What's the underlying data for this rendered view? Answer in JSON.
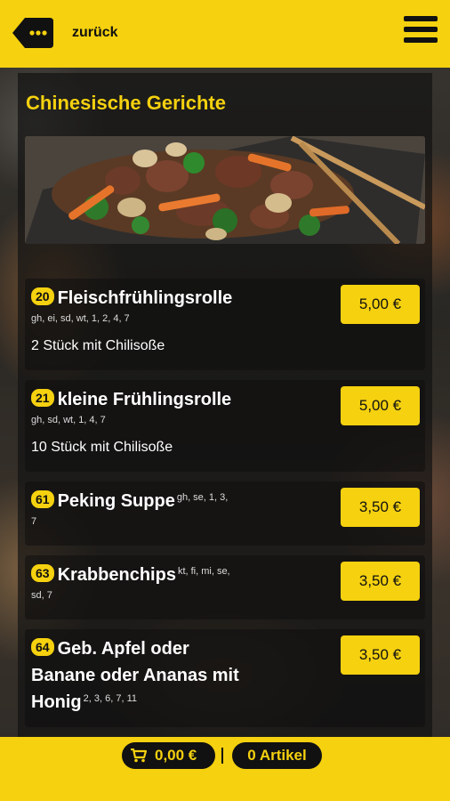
{
  "header": {
    "back_label": "zurück",
    "back_icon": "back-tag-icon",
    "menu_icon": "hamburger-menu-icon"
  },
  "section": {
    "title": "Chinesische Gerichte",
    "image_alt": "beef-broccoli-dish-photo"
  },
  "items": [
    {
      "number": "20",
      "name": "Fleischfrühlingsrolle",
      "allergens": "gh, ei, sd, wt, 1, 2, 4, 7",
      "description": "2 Stück mit Chilisoße",
      "price": "5,00 €"
    },
    {
      "number": "21",
      "name": "kleine Frühlingsrolle",
      "allergens": "gh, sd, wt, 1, 4, 7",
      "description": "10 Stück mit Chilisoße",
      "price": "5,00 €"
    },
    {
      "number": "61",
      "name": "Peking Suppe",
      "allergens_a": "gh, se, 1, 3,",
      "allergens_b": "7",
      "price": "3,50 €"
    },
    {
      "number": "63",
      "name": "Krabbenchips",
      "allergens_a": "kt, fi, mi, se,",
      "allergens_b": "sd, 7",
      "price": "3,50 €"
    },
    {
      "number": "64",
      "name_a": "Geb. Apfel oder",
      "name_b": "Banane oder Ananas mit",
      "name_c": "Honig",
      "allergens": "2, 3, 6, 7, 11",
      "price": "3,50 €"
    }
  ],
  "footer": {
    "cart_total": "0,00 €",
    "cart_icon": "shopping-cart-icon",
    "article_count": "0 Artikel"
  },
  "colors": {
    "accent": "#f5d10f",
    "dark": "#111111"
  }
}
